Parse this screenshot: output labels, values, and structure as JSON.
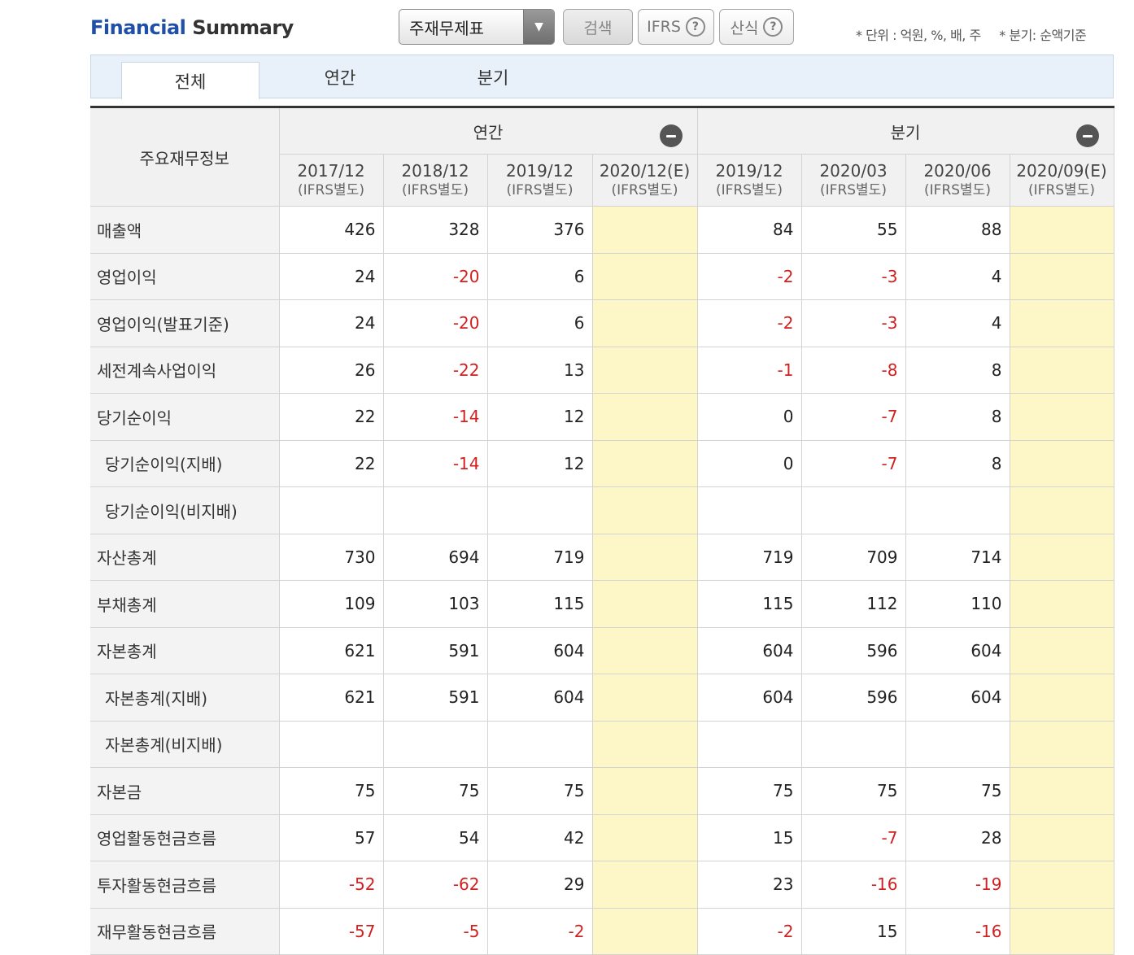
{
  "header": {
    "title_part1": "Financial",
    "title_part2": "Summary",
    "select_value": "주재무제표",
    "search_label": "검색",
    "ifrs_label": "IFRS",
    "formula_label": "산식",
    "help_symbol": "?",
    "note_unit": "* 단위 : 억원, %, 배, 주",
    "note_quarter": "* 분기: 순액기준"
  },
  "tabs": [
    {
      "label": "전체",
      "active": true
    },
    {
      "label": "연간",
      "active": false
    },
    {
      "label": "분기",
      "active": false
    }
  ],
  "table": {
    "row_header": "주요재무정보",
    "groups": [
      {
        "label": "연간"
      },
      {
        "label": "분기"
      }
    ],
    "periods": [
      {
        "date": "2017/12",
        "sub": "(IFRS별도)"
      },
      {
        "date": "2018/12",
        "sub": "(IFRS별도)"
      },
      {
        "date": "2019/12",
        "sub": "(IFRS별도)"
      },
      {
        "date": "2020/12(E)",
        "sub": "(IFRS별도)"
      },
      {
        "date": "2019/12",
        "sub": "(IFRS별도)"
      },
      {
        "date": "2020/03",
        "sub": "(IFRS별도)"
      },
      {
        "date": "2020/06",
        "sub": "(IFRS별도)"
      },
      {
        "date": "2020/09(E)",
        "sub": "(IFRS별도)"
      }
    ],
    "rows": [
      {
        "label": "매출액",
        "indent": false,
        "values": [
          "426",
          "328",
          "376",
          "",
          "84",
          "55",
          "88",
          ""
        ]
      },
      {
        "label": "영업이익",
        "indent": false,
        "values": [
          "24",
          "-20",
          "6",
          "",
          "-2",
          "-3",
          "4",
          ""
        ]
      },
      {
        "label": "영업이익(발표기준)",
        "indent": false,
        "values": [
          "24",
          "-20",
          "6",
          "",
          "-2",
          "-3",
          "4",
          ""
        ]
      },
      {
        "label": "세전계속사업이익",
        "indent": false,
        "values": [
          "26",
          "-22",
          "13",
          "",
          "-1",
          "-8",
          "8",
          ""
        ]
      },
      {
        "label": "당기순이익",
        "indent": false,
        "values": [
          "22",
          "-14",
          "12",
          "",
          "0",
          "-7",
          "8",
          ""
        ]
      },
      {
        "label": "당기순이익(지배)",
        "indent": true,
        "values": [
          "22",
          "-14",
          "12",
          "",
          "0",
          "-7",
          "8",
          ""
        ]
      },
      {
        "label": "당기순이익(비지배)",
        "indent": true,
        "values": [
          "",
          "",
          "",
          "",
          "",
          "",
          "",
          ""
        ]
      },
      {
        "label": "자산총계",
        "indent": false,
        "values": [
          "730",
          "694",
          "719",
          "",
          "719",
          "709",
          "714",
          ""
        ]
      },
      {
        "label": "부채총계",
        "indent": false,
        "values": [
          "109",
          "103",
          "115",
          "",
          "115",
          "112",
          "110",
          ""
        ]
      },
      {
        "label": "자본총계",
        "indent": false,
        "values": [
          "621",
          "591",
          "604",
          "",
          "604",
          "596",
          "604",
          ""
        ]
      },
      {
        "label": "자본총계(지배)",
        "indent": true,
        "values": [
          "621",
          "591",
          "604",
          "",
          "604",
          "596",
          "604",
          ""
        ]
      },
      {
        "label": "자본총계(비지배)",
        "indent": true,
        "values": [
          "",
          "",
          "",
          "",
          "",
          "",
          "",
          ""
        ]
      },
      {
        "label": "자본금",
        "indent": false,
        "values": [
          "75",
          "75",
          "75",
          "",
          "75",
          "75",
          "75",
          ""
        ]
      },
      {
        "label": "영업활동현금흐름",
        "indent": false,
        "values": [
          "57",
          "54",
          "42",
          "",
          "15",
          "-7",
          "28",
          ""
        ]
      },
      {
        "label": "투자활동현금흐름",
        "indent": false,
        "values": [
          "-52",
          "-62",
          "29",
          "",
          "23",
          "-16",
          "-19",
          ""
        ]
      },
      {
        "label": "재무활동현금흐름",
        "indent": false,
        "values": [
          "-57",
          "-5",
          "-2",
          "",
          "-2",
          "15",
          "-16",
          ""
        ]
      }
    ]
  },
  "colors": {
    "title_blue": "#1f4fa8",
    "negative_red": "#d02020",
    "estimate_fill": "#fdf7c8",
    "tab_bar_bg": "#e8f0fa"
  },
  "icons": {
    "collapse": "minus-circle-icon",
    "help": "question-circle-icon",
    "dropdown": "triangle-down-icon"
  }
}
